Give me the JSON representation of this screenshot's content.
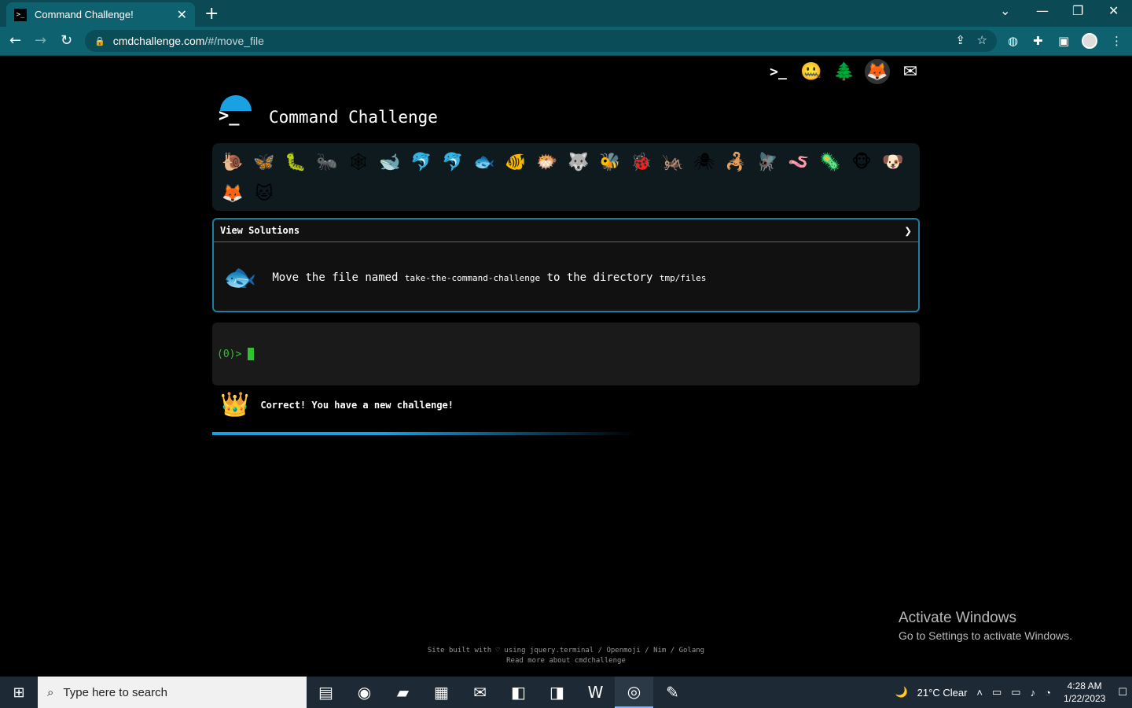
{
  "browser": {
    "tab_title": "Command Challenge!",
    "tab_close": "✕",
    "new_tab": "+",
    "url_host": "cmdchallenge.com",
    "url_path": "/#/move_file"
  },
  "page": {
    "title": "Command Challenge",
    "top_icons": [
      {
        "icon": "terminal-icon",
        "glyph": ">_"
      },
      {
        "icon": "zipper-mouth-icon",
        "glyph": "🤐"
      },
      {
        "icon": "tree-icon",
        "glyph": "🌲"
      },
      {
        "icon": "gitlab-icon",
        "glyph": "🦊"
      },
      {
        "icon": "mail-icon",
        "glyph": "✉"
      }
    ],
    "animals": [
      "🐌",
      "🦋",
      "🐛",
      "🐜",
      "🕸",
      "🐋",
      "🐬",
      "🐬",
      "🐟",
      "🐠",
      "🐡",
      "🐺",
      "🐝",
      "🐞",
      "🦗",
      "🕷",
      "🦂",
      "🪰",
      "🪱",
      "🦠",
      "🐵",
      "🐶",
      "🦊",
      "🐱"
    ],
    "active_animal_index": 8,
    "challenge": {
      "header": "View Solutions",
      "chevron": "❯",
      "fish_glyph": "🐟",
      "text_before": "Move the file named ",
      "file_name": "take-the-command-challenge",
      "text_middle": " to the directory ",
      "dir_name": "tmp/files"
    },
    "terminal": {
      "prompt": "(0)>"
    },
    "status": {
      "glyph": "👑",
      "message": "Correct! You have a new challenge!"
    },
    "activate": {
      "line1": "Activate Windows",
      "line2": "Go to Settings to activate Windows."
    },
    "footer": {
      "line1": "Site built with ♡ using jquery.terminal / Openmoji / Nim / Golang",
      "line2": "Read more about cmdchallenge"
    }
  },
  "taskbar": {
    "search_placeholder": "Type here to search",
    "weather": "21°C  Clear",
    "time": "4:28 AM",
    "date": "1/22/2023"
  }
}
